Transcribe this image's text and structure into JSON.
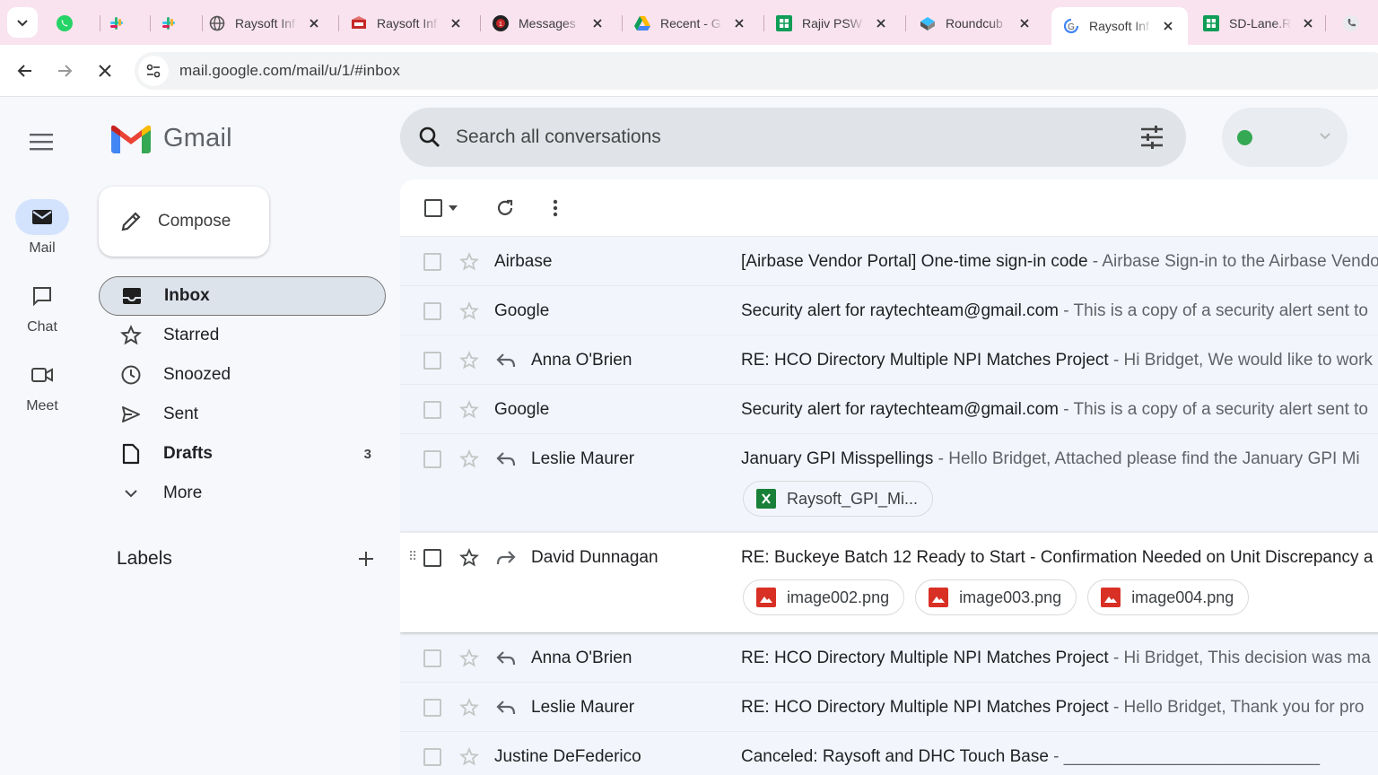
{
  "browser": {
    "tabs": [
      {
        "title": "",
        "icon": "whatsapp-icon"
      },
      {
        "title": "",
        "icon": "slack-icon"
      },
      {
        "title": "",
        "icon": "slack-icon"
      },
      {
        "title": "Raysoft Inf",
        "icon": "globe-icon"
      },
      {
        "title": "Raysoft Inf",
        "icon": "raysoft-icon"
      },
      {
        "title": "Messages",
        "icon": "messages-icon"
      },
      {
        "title": "Recent - G",
        "icon": "google-drive-icon"
      },
      {
        "title": "Rajiv PSW",
        "icon": "sheets-icon"
      },
      {
        "title": "Roundcub",
        "icon": "roundcube-icon"
      },
      {
        "title": "Raysoft Inf",
        "icon": "google-loading-icon"
      },
      {
        "title": "SD-Lane.R",
        "icon": "sheets-icon"
      },
      {
        "title": "",
        "icon": "phone-icon"
      }
    ],
    "url": "mail.google.com/mail/u/1/#inbox"
  },
  "rail": {
    "mail_label": "Mail",
    "chat_label": "Chat",
    "meet_label": "Meet"
  },
  "logo_text": "Gmail",
  "compose_label": "Compose",
  "nav": {
    "inbox": "Inbox",
    "starred": "Starred",
    "snoozed": "Snoozed",
    "sent": "Sent",
    "drafts": "Drafts",
    "drafts_count": "3",
    "more": "More"
  },
  "labels_heading": "Labels",
  "search": {
    "placeholder": "Search all conversations"
  },
  "colors": {
    "accent": "#0b57d0",
    "status_green": "#34a853",
    "active_nav": "#dde3ea"
  },
  "emails": [
    {
      "sender": "Airbase",
      "subject": "[Airbase Vendor Portal] One-time sign-in code",
      "snippet": " - Airbase Sign-in to the Airbase Vendor Portal"
    },
    {
      "sender": "Google",
      "subject": "Security alert for raytechteam@gmail.com",
      "snippet": " - This is a copy of a security alert sent to"
    },
    {
      "sender": "Anna O'Brien",
      "subject": "RE: HCO Directory Multiple NPI Matches Project",
      "snippet": " - Hi Bridget, We would like to work"
    },
    {
      "sender": "Google",
      "subject": "Security alert for raytechteam@gmail.com",
      "snippet": " - This is a copy of a security alert sent to"
    },
    {
      "sender": "Leslie Maurer",
      "subject": "January GPI Misspellings",
      "snippet": " - Hello Bridget, Attached please find the January GPI Mi",
      "attachments": [
        "Raysoft_GPI_Mi..."
      ]
    },
    {
      "sender": "David Dunnagan",
      "subject": "RE: Buckeye Batch 12 Ready to Start - Confirmation Needed on Unit Discrepancy a",
      "snippet": "",
      "attachments": [
        "image002.png",
        "image003.png",
        "image004.png"
      ]
    },
    {
      "sender": "Anna O'Brien",
      "subject": "RE: HCO Directory Multiple NPI Matches Project",
      "snippet": " - Hi Bridget, This decision was ma"
    },
    {
      "sender": "Leslie Maurer",
      "subject": "RE: HCO Directory Multiple NPI Matches Project",
      "snippet": " - Hello Bridget, Thank you for pro"
    },
    {
      "sender": "Justine DeFederico",
      "subject": "Canceled: Raysoft and DHC Touch Base",
      "snippet": " - ___________________________"
    }
  ]
}
